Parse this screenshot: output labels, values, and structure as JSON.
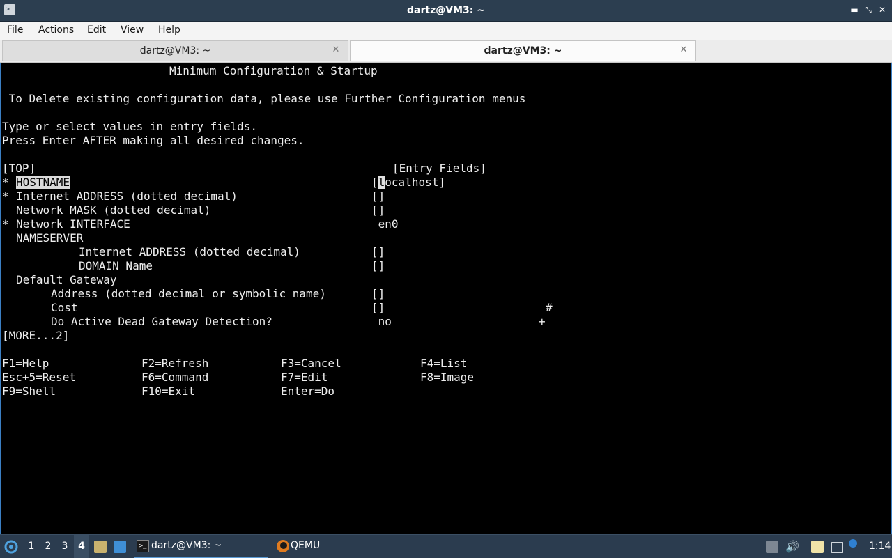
{
  "window": {
    "title": "dartz@VM3: ~",
    "app_icon_glyph": ">_",
    "controls": {
      "minimize": "▬",
      "maximize": "⤡",
      "close": "✕"
    }
  },
  "menubar": {
    "items": [
      "File",
      "Actions",
      "Edit",
      "View",
      "Help"
    ]
  },
  "tabs": [
    {
      "label": "dartz@VM3: ~",
      "active": false,
      "close": "✕"
    },
    {
      "label": "dartz@VM3: ~",
      "active": true,
      "close": "✕"
    }
  ],
  "terminal": {
    "screen_title": "Minimum Configuration & Startup",
    "notice": " To Delete existing configuration data, please use Further Configuration menus",
    "instructions": [
      "Type or select values in entry fields.",
      "Press Enter AFTER making all desired changes."
    ],
    "top_marker": "[TOP]",
    "entry_header": "[Entry Fields]",
    "fields": [
      {
        "required": true,
        "indent": 0,
        "label": "HOSTNAME",
        "value": "[localhost]",
        "hint": ""
      },
      {
        "required": true,
        "indent": 0,
        "label": "Internet ADDRESS (dotted decimal)",
        "value": "[]",
        "hint": ""
      },
      {
        "required": false,
        "indent": 0,
        "label": "Network MASK (dotted decimal)",
        "value": "[]",
        "hint": ""
      },
      {
        "required": true,
        "indent": 0,
        "label": "Network INTERFACE",
        "value": " en0",
        "hint": ""
      },
      {
        "required": false,
        "indent": 0,
        "label": "NAMESERVER",
        "value": "",
        "hint": ""
      },
      {
        "required": false,
        "indent": 2,
        "label": "Internet ADDRESS (dotted decimal)",
        "value": "[]",
        "hint": ""
      },
      {
        "required": false,
        "indent": 2,
        "label": "DOMAIN Name",
        "value": "[]",
        "hint": ""
      },
      {
        "required": false,
        "indent": 0,
        "label": "Default Gateway",
        "value": "",
        "hint": ""
      },
      {
        "required": false,
        "indent": 1,
        "label": "Address (dotted decimal or symbolic name)",
        "value": "[]",
        "hint": ""
      },
      {
        "required": false,
        "indent": 1,
        "label": "Cost",
        "value": "[]",
        "hint": "#"
      },
      {
        "required": false,
        "indent": 1,
        "label": "Do Active Dead Gateway Detection?",
        "value": " no",
        "hint": "+"
      }
    ],
    "more_marker": "[MORE...2]",
    "function_keys": [
      [
        "F1=Help",
        "F2=Refresh",
        "F3=Cancel",
        "F4=List"
      ],
      [
        "Esc+5=Reset",
        "F6=Command",
        "F7=Edit",
        "F8=Image"
      ],
      [
        "F9=Shell",
        "F10=Exit",
        "Enter=Do",
        ""
      ]
    ]
  },
  "taskbar": {
    "workspaces": [
      "1",
      "2",
      "3",
      "4"
    ],
    "active_workspace": "4",
    "tasks": [
      {
        "label": "dartz@VM3: ~",
        "icon": "terminal-icon",
        "active": true
      },
      {
        "label": "QEMU",
        "icon": "qemu-icon",
        "active": false
      }
    ],
    "clock": "1:14",
    "colors": {
      "panel": "#2b3c4f",
      "accent": "#5b9bd5"
    }
  }
}
